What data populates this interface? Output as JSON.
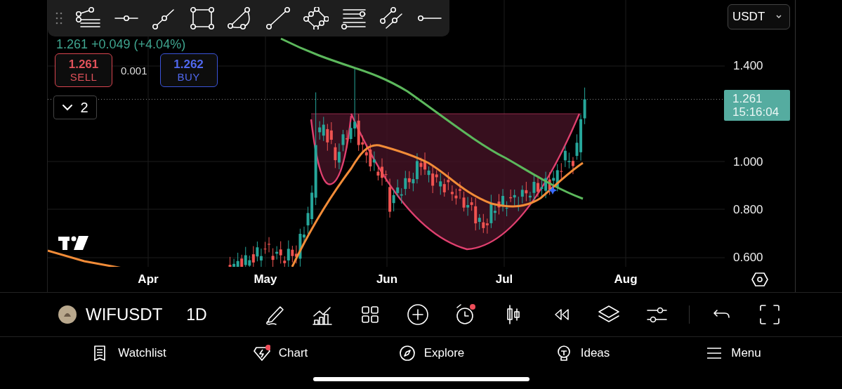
{
  "quote": {
    "last": "1.261",
    "change": "+0.049 (+4.04%)"
  },
  "trade": {
    "sell_price": "1.261",
    "sell_label": "SELL",
    "spread": "0.001",
    "buy_price": "1.262",
    "buy_label": "BUY"
  },
  "indicators_toggle": {
    "count": "2",
    "expanded": false
  },
  "currency_select": {
    "value": "USDT"
  },
  "price_axis": {
    "labels": [
      "1.400",
      "1.000",
      "0.800",
      "0.600"
    ],
    "last_price": "1.261",
    "countdown": "15:16:04"
  },
  "time_axis": {
    "labels": [
      "Apr",
      "May",
      "Jun",
      "Jul",
      "Aug"
    ]
  },
  "symbol_bar": {
    "symbol": "WIFUSDT",
    "interval": "1D",
    "alert_badge": true
  },
  "bottom_nav": [
    {
      "kind": "watchlist",
      "label": "Watchlist",
      "badge": false
    },
    {
      "kind": "chart",
      "label": "Chart",
      "badge": true
    },
    {
      "kind": "explore",
      "label": "Explore",
      "badge": false
    },
    {
      "kind": "ideas",
      "label": "Ideas",
      "badge": false
    },
    {
      "kind": "menu",
      "label": "Menu",
      "badge": false
    }
  ]
}
